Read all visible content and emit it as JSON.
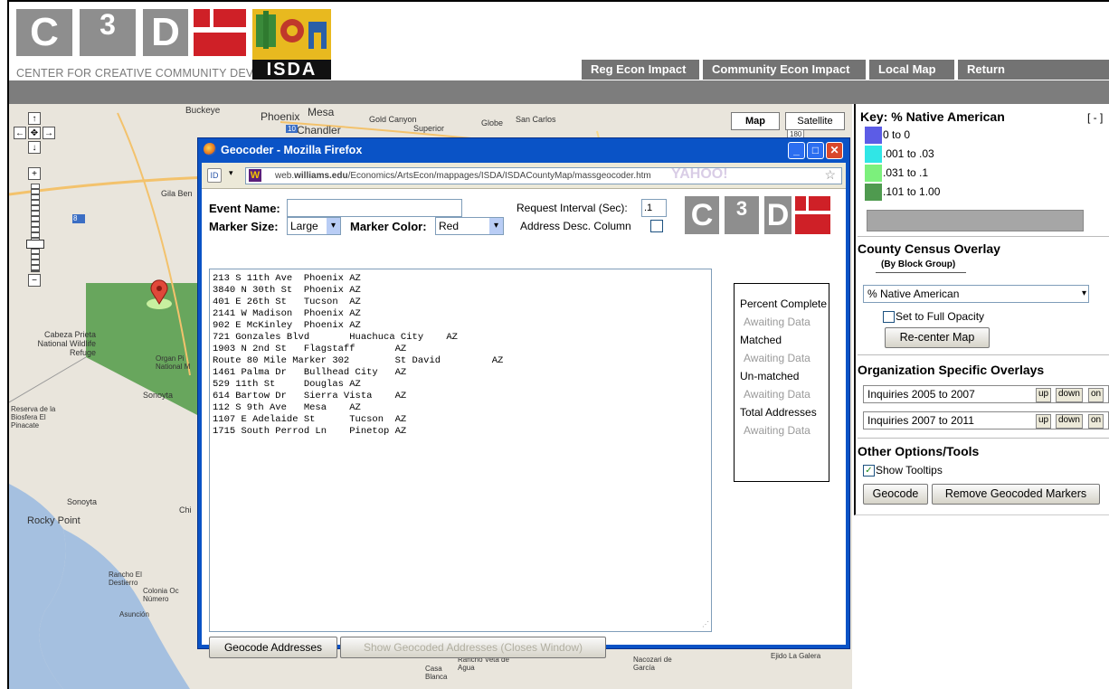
{
  "header": {
    "logo_tiles": [
      "C",
      "3",
      "D"
    ],
    "tagline": "CENTER FOR CREATIVE COMMUNITY DEVELOPMENT",
    "isda_label": "ISDA",
    "nav": [
      "Reg Econ Impact",
      "Community Econ Impact",
      "Local Map",
      "Return"
    ]
  },
  "map": {
    "type_buttons": [
      "Map",
      "Satellite"
    ],
    "labels": [
      "Buckeye",
      "Phoenix",
      "Mesa",
      "Chandler",
      "Gold Canyon",
      "Superior",
      "Globe",
      "San Carlos",
      "Gila Ben",
      "Cabeza Prieta National Wildlife Refuge",
      "Organ Pi National M",
      "Sonoyta",
      "Reserva de la Biosfera El Pinacate",
      "Sonoyta",
      "Chi",
      "Rocky Point",
      "Rancho El Destierro",
      "Colonia Oc Número",
      "Asunción",
      "Rancho Veta de Agua",
      "Casa Blanca",
      "Nacozari de García",
      "Ejido La Galera"
    ],
    "shield_labels": [
      "10",
      "8",
      "180"
    ]
  },
  "window": {
    "title": "Geocoder - Mozilla Firefox",
    "url_prefix": "web.",
    "url_host": "williams.edu",
    "url_path": "/Economics/ArtsEcon/mappages/ISDA/ISDACountyMap/massgeocoder.htm",
    "url_watermark": "YAHOO!",
    "form": {
      "event_label": "Event Name:",
      "event_value": "",
      "marker_size_label": "Marker Size:",
      "marker_size_value": "Large",
      "marker_color_label": "Marker Color:",
      "marker_color_value": "Red",
      "interval_label": "Request Interval (Sec):",
      "interval_value": ".1",
      "addr_desc_label": "Address Desc. Column"
    },
    "addresses": [
      "213 S 11th Ave  Phoenix AZ",
      "3840 N 30th St  Phoenix AZ",
      "401 E 26th St   Tucson  AZ",
      "2141 W Madison  Phoenix AZ",
      "902 E McKinley  Phoenix AZ",
      "721 Gonzales Blvd       Huachuca City    AZ",
      "1903 N 2nd St   Flagstaff       AZ",
      "Route 80 Mile Marker 302        St David         AZ",
      "1461 Palma Dr   Bullhead City   AZ",
      "529 11th St     Douglas AZ",
      "614 Bartow Dr   Sierra Vista    AZ",
      "112 S 9th Ave   Mesa    AZ",
      "1107 E Adelaide St      Tucson  AZ",
      "1715 South Perrod Ln    Pinetop AZ"
    ],
    "status": [
      {
        "label": "Percent Complete",
        "value": "Awaiting Data"
      },
      {
        "label": "Matched",
        "value": "Awaiting Data"
      },
      {
        "label": "Un-matched",
        "value": "Awaiting Data"
      },
      {
        "label": "Total Addresses",
        "value": "Awaiting Data"
      }
    ],
    "geocode_button": "Geocode Addresses",
    "show_button": "Show Geocoded Addresses (Closes Window)"
  },
  "panel": {
    "key_title": "Key: % Native American",
    "collapse_label": "[ - ]",
    "key_items": [
      {
        "label": "0 to 0",
        "color": "#5c5ce6"
      },
      {
        "label": ".001 to .03",
        "color": "#30e6e6"
      },
      {
        "label": ".031 to .1",
        "color": "#7cf07c"
      },
      {
        "label": ".101 to 1.00",
        "color": "#4f9a4f"
      }
    ],
    "census_title": "County Census Overlay",
    "census_sub": "(By Block Group)",
    "census_select": "% Native American",
    "full_opacity_label": "Set to Full Opacity",
    "recenter_label": "Re-center Map",
    "org_title": "Organization Specific Overlays",
    "org_overlays": [
      {
        "label": "Inquiries 2005 to 2007"
      },
      {
        "label": "Inquiries 2007 to 2011"
      }
    ],
    "overlay_buttons": [
      "up",
      "down",
      "on"
    ],
    "other_title": "Other Options/Tools",
    "tooltips_label": "Show Tooltips",
    "geocode_label": "Geocode",
    "remove_label": "Remove Geocoded Markers"
  }
}
